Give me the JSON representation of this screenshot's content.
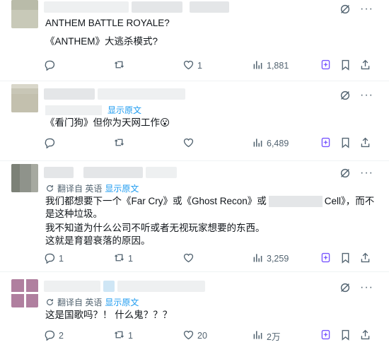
{
  "tweets": [
    {
      "translate_label": "",
      "show_original": "",
      "lines": [
        "ANTHEM BATTLE ROYALE?",
        "《ANTHEM》大逃杀模式?"
      ],
      "actions": {
        "replies": "",
        "reposts": "",
        "likes": "1",
        "views": "1,881"
      }
    },
    {
      "translate_label": "",
      "show_original": "显示原文",
      "lines": [
        "《看门狗》但你为天网工作😮"
      ],
      "actions": {
        "replies": "",
        "reposts": "",
        "likes": "",
        "views": "6,489"
      }
    },
    {
      "translate_label": "翻译自 英语",
      "show_original": "显示原文",
      "lines_a_pre": "我们都想要下一个《Far Cry》或《Ghost Recon》或",
      "lines_a_post": "Cell》，而不",
      "lines": [
        "是这种垃圾。",
        "我不知道为什么公司不听或者无视玩家想要的东西。",
        "这就是育碧衰落的原因。"
      ],
      "actions": {
        "replies": "1",
        "reposts": "1",
        "likes": "",
        "views": "3,259"
      }
    },
    {
      "translate_label": "翻译自 英语",
      "show_original": "显示原文",
      "lines": [
        "这是国歌吗？！ 什么鬼？？？"
      ],
      "actions": {
        "replies": "2",
        "reposts": "1",
        "likes": "20",
        "views": "2万"
      }
    }
  ],
  "icons": {
    "reply": "reply-icon",
    "repost": "repost-icon",
    "like": "heart-icon",
    "views": "views-icon",
    "grok": "grok-icon",
    "bookmark": "bookmark-icon",
    "share": "share-icon",
    "more": "more-icon",
    "translate": "translate-icon"
  },
  "colors": {
    "link": "#1d9bf0",
    "muted": "#536471",
    "grok": "#7856ff",
    "text": "#0f1419"
  }
}
